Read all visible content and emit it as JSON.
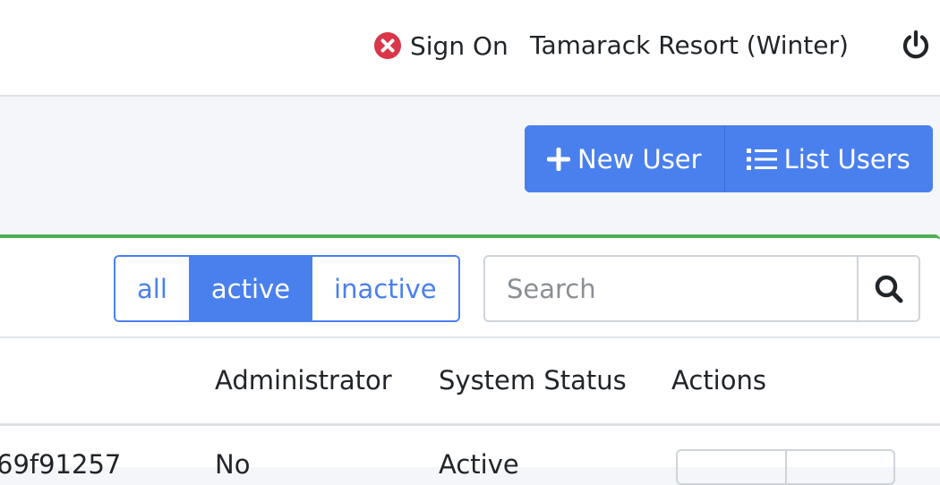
{
  "header": {
    "signon_label": "Sign On",
    "resort_name": "Tamarack Resort (Winter)",
    "signon_icon": "x-circle-icon",
    "power_icon": "power-icon",
    "error_color": "#d9364a"
  },
  "toolbar": {
    "new_user_label": "New User",
    "list_users_label": "List Users",
    "accent_color": "#4a80ee"
  },
  "filters": {
    "options": [
      "all",
      "active",
      "inactive"
    ],
    "selected": "active"
  },
  "search": {
    "placeholder": "Search",
    "value": ""
  },
  "table": {
    "columns": [
      "Administrator",
      "System Status",
      "Actions"
    ],
    "rows": [
      {
        "id_fragment": "69f91257",
        "administrator": "No",
        "status": "Active"
      }
    ]
  },
  "card": {
    "accent_color": "#4caf50"
  }
}
